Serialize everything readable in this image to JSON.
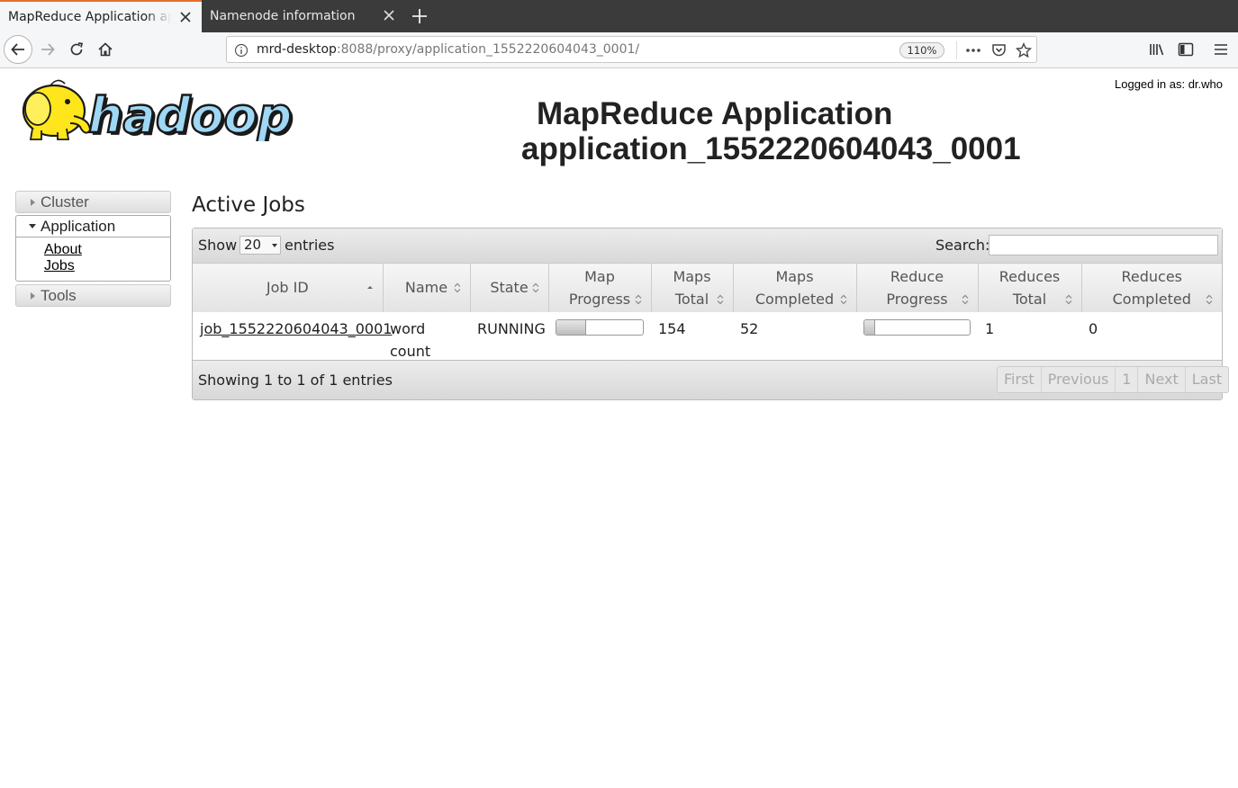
{
  "browser": {
    "tabs": [
      {
        "title": "MapReduce Application application_1552220604043_0001",
        "active": true
      },
      {
        "title": "Namenode information",
        "active": false
      }
    ],
    "url": {
      "host": "mrd-desktop",
      "rest": ":8088/proxy/application_1552220604043_0001/"
    },
    "zoom": "110%"
  },
  "header": {
    "logged_in": "Logged in as: dr.who",
    "title_line1": "MapReduce Application",
    "title_line2": "application_1552220604043_0001"
  },
  "sidebar": {
    "cluster": "Cluster",
    "application": "Application",
    "app_links": [
      "About",
      "Jobs"
    ],
    "tools": "Tools"
  },
  "main": {
    "heading": "Active Jobs",
    "show_label": "Show",
    "show_value": "20",
    "entries_label": "entries",
    "search_label": "Search:",
    "columns": [
      {
        "line1": "Job ID",
        "line2": ""
      },
      {
        "line1": "Name",
        "line2": ""
      },
      {
        "line1": "State",
        "line2": ""
      },
      {
        "line1": "Map",
        "line2": "Progress"
      },
      {
        "line1": "Maps",
        "line2": "Total"
      },
      {
        "line1": "Maps",
        "line2": "Completed"
      },
      {
        "line1": "Reduce",
        "line2": "Progress"
      },
      {
        "line1": "Reduces",
        "line2": "Total"
      },
      {
        "line1": "Reduces",
        "line2": "Completed"
      }
    ],
    "rows": [
      {
        "job_id": "job_1552220604043_0001",
        "name": "word count",
        "state": "RUNNING",
        "map_progress_pct": 34,
        "maps_total": "154",
        "maps_completed": "52",
        "reduce_progress_pct": 10,
        "reduces_total": "1",
        "reduces_completed": "0"
      }
    ],
    "showing": "Showing 1 to 1 of 1 entries",
    "pager": [
      "First",
      "Previous",
      "1",
      "Next",
      "Last"
    ]
  }
}
